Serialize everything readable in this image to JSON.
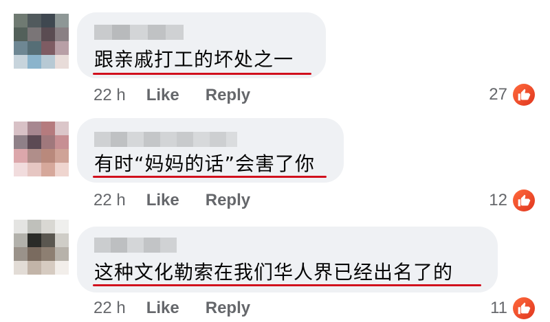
{
  "comments": [
    {
      "text": "跟亲戚打工的坏处之一",
      "time": "22 h",
      "like_label": "Like",
      "reply_label": "Reply",
      "reaction_count": "27",
      "reaction_icon": "like-icon",
      "underline_color": "#d10f1c"
    },
    {
      "text": "有时“妈妈的话”会害了你",
      "time": "22 h",
      "like_label": "Like",
      "reply_label": "Reply",
      "reaction_count": "12",
      "reaction_icon": "like-icon",
      "underline_color": "#d10f1c"
    },
    {
      "text": "这种文化勒索在我们华人界已经出名了的",
      "time": "22 h",
      "like_label": "Like",
      "reply_label": "Reply",
      "reaction_count": "11",
      "reaction_icon": "like-icon",
      "underline_color": "#d10f1c"
    }
  ],
  "colors": {
    "bubble_bg": "#eff1f4",
    "meta_text": "#65676b",
    "reaction_badge": "#e8472a",
    "underline": "#d10f1c"
  }
}
